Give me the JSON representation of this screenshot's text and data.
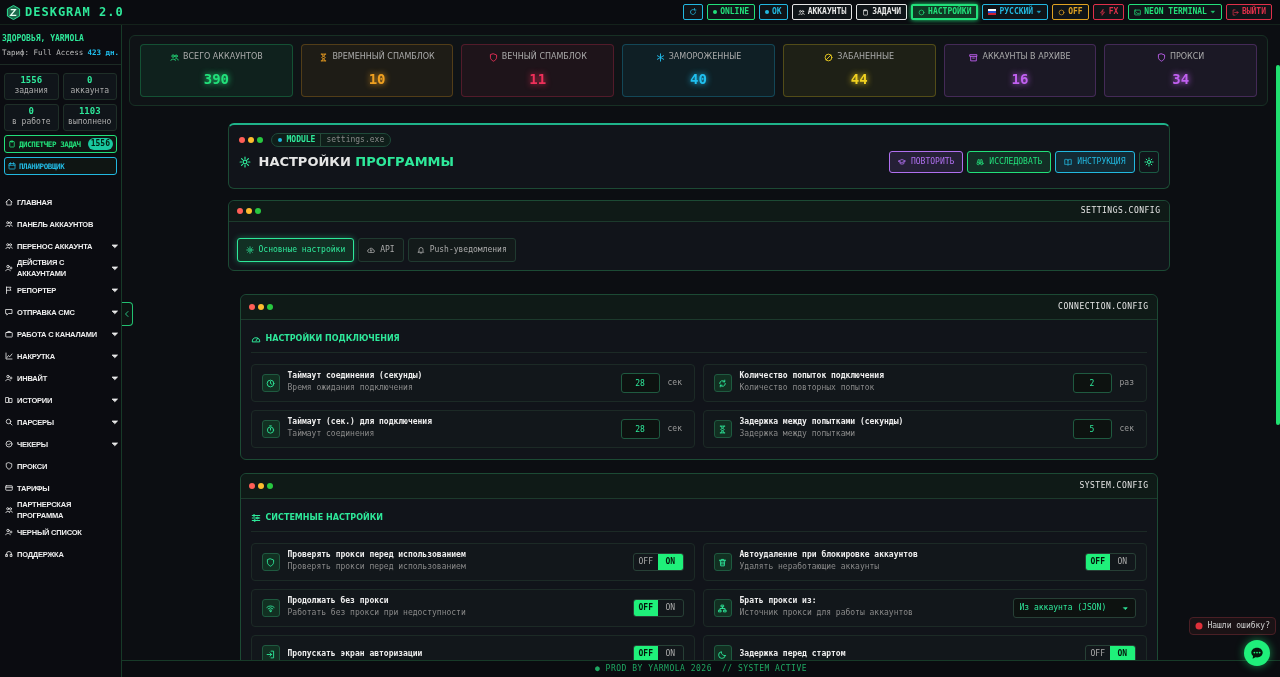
{
  "app": {
    "title": "DESKGRAM 2.0"
  },
  "topbar": [
    {
      "kind": "icon",
      "color": "#22b8e0",
      "selected": false
    },
    {
      "kind": "status",
      "label": "ONLINE",
      "color": "#22e07a",
      "selected": false
    },
    {
      "kind": "status",
      "label": "OK",
      "color": "#22b8e0",
      "selected": false
    },
    {
      "kind": "nav",
      "label": "АККАУНТЫ",
      "color": "#e6e6e6",
      "selected": false
    },
    {
      "kind": "nav",
      "label": "ЗАДАЧИ",
      "color": "#e6e6e6",
      "selected": false
    },
    {
      "kind": "nav",
      "label": "НАСТРОЙКИ",
      "color": "#22e07a",
      "selected": true
    },
    {
      "kind": "dropdown",
      "label": "РУССКИЙ",
      "color": "#22b8e0",
      "selected": false
    },
    {
      "kind": "nav",
      "label": "OFF",
      "color": "#e0a222",
      "selected": false
    },
    {
      "kind": "nav",
      "label": "FX",
      "color": "#e0304a",
      "selected": false
    },
    {
      "kind": "dropdown",
      "label": "NEON TERMINAL",
      "color": "#22e07a",
      "selected": false
    },
    {
      "kind": "nav",
      "label": "ВЫЙТИ",
      "color": "#e0304a",
      "selected": false
    }
  ],
  "sidebar": {
    "greeting": "ЗДОРОВЬЯ, YARMOLA",
    "plan": "Тариф: Full Access",
    "days": "423 дн.",
    "counters": [
      {
        "value": "1556",
        "label": "задания"
      },
      {
        "value": "0",
        "label": "аккаунта"
      },
      {
        "value": "0",
        "label": "в работе"
      },
      {
        "value": "1103",
        "label": "выполнено"
      }
    ],
    "actions": [
      {
        "label": "ДИСПЕТЧЕР ЗАДАЧ",
        "badge": "1556",
        "color": "#22e07a"
      },
      {
        "label": "ПЛАНИРОВЩИК",
        "color": "#22b8e0"
      }
    ],
    "menu": [
      {
        "label": "ГЛАВНАЯ",
        "expandable": false
      },
      {
        "label": "ПАНЕЛЬ АККАУНТОВ",
        "expandable": false
      },
      {
        "label": "ПЕРЕНОС АККАУНТА",
        "expandable": true
      },
      {
        "label": "ДЕЙСТВИЯ С АККАУНТАМИ",
        "expandable": true
      },
      {
        "label": "РЕПОРТЕР",
        "expandable": true
      },
      {
        "label": "ОТПРАВКА СМС",
        "expandable": true
      },
      {
        "label": "РАБОТА С КАНАЛАМИ",
        "expandable": true
      },
      {
        "label": "НАКРУТКА",
        "expandable": true
      },
      {
        "label": "ИНВАЙТ",
        "expandable": true
      },
      {
        "label": "ИСТОРИИ",
        "expandable": true
      },
      {
        "label": "ПАРСЕРЫ",
        "expandable": true
      },
      {
        "label": "ЧЕКЕРЫ",
        "expandable": true
      },
      {
        "label": "ПРОКСИ",
        "expandable": false
      },
      {
        "label": "ТАРИФЫ",
        "expandable": false
      },
      {
        "label": "ПАРТНЕРСКАЯ ПРОГРАММА",
        "expandable": false
      },
      {
        "label": "ЧЕРНЫЙ СПИСОК",
        "expandable": false
      },
      {
        "label": "ПОДДЕРЖКА",
        "expandable": false
      }
    ]
  },
  "stats": [
    {
      "label": "ВСЕГО АККАУНТОВ",
      "value": "390",
      "color": "#22e07a"
    },
    {
      "label": "ВРЕМЕННЫЙ СПАМБЛОК",
      "value": "10",
      "color": "#f0a020"
    },
    {
      "label": "ВЕЧНЫЙ СПАМБЛОК",
      "value": "11",
      "color": "#f0305a"
    },
    {
      "label": "ЗАМОРОЖЕННЫЕ",
      "value": "40",
      "color": "#20c0f0"
    },
    {
      "label": "ЗАБАНЕННЫЕ",
      "value": "44",
      "color": "#f0d020"
    },
    {
      "label": "АККАУНТЫ В АРХИВЕ",
      "value": "16",
      "color": "#c060f0"
    },
    {
      "label": "ПРОКСИ",
      "value": "34",
      "color": "#c060f0"
    }
  ],
  "page": {
    "module_tag": "MODULE",
    "module_file": "settings.exe",
    "title": "НАСТРОЙКИ",
    "title_accent": "ПРОГРАММЫ",
    "buttons": [
      {
        "label": "ПОВТОРИТЬ",
        "color": "#b070f0"
      },
      {
        "label": "ИССЛЕДОВАТЬ",
        "color": "#22e07a"
      },
      {
        "label": "ИНСТРУКЦИЯ",
        "color": "#22b8e0"
      }
    ]
  },
  "tabs_panel": {
    "file": "SETTINGS.CONFIG",
    "tabs": [
      {
        "label": "Основные настройки",
        "selected": true
      },
      {
        "label": "API",
        "selected": false
      },
      {
        "label": "Push-уведомления",
        "selected": false
      }
    ]
  },
  "sections": [
    {
      "file": "CONNECTION.CONFIG",
      "title": "НАСТРОЙКИ ПОДКЛЮЧЕНИЯ",
      "rows": [
        {
          "kind": "number",
          "label": "Таймаут соединения (секунды)",
          "hint": "Время ожидания подключения",
          "value": "28",
          "unit": "сек"
        },
        {
          "kind": "number",
          "label": "Количество попыток подключения",
          "hint": "Количество повторных попыток",
          "value": "2",
          "unit": "раз"
        },
        {
          "kind": "number",
          "label": "Таймаут (сек.) для подключения",
          "hint": "Таймаут соединения",
          "value": "28",
          "unit": "сек"
        },
        {
          "kind": "number",
          "label": "Задержка между попытками (секунды)",
          "hint": "Задержка между попытками",
          "value": "5",
          "unit": "сек"
        }
      ]
    },
    {
      "file": "SYSTEM.CONFIG",
      "title": "СИСТЕМНЫЕ НАСТРОЙКИ",
      "rows": [
        {
          "kind": "toggle",
          "label": "Проверять прокси перед использованием",
          "hint": "Проверять прокси перед использованием",
          "off_label": "OFF",
          "on_label": "ON",
          "on": true
        },
        {
          "kind": "toggle",
          "label": "Автоудаление при блокировке аккаунтов",
          "hint": "Удалять неработающие аккаунты",
          "off_label": "OFF",
          "on_label": "ON",
          "on": false
        },
        {
          "kind": "toggle",
          "label": "Продолжать без прокси",
          "hint": "Работать без прокси при недоступности",
          "off_label": "OFF",
          "on_label": "ON",
          "on": false
        },
        {
          "kind": "select",
          "label": "Брать прокси из:",
          "hint": "Источник прокси для работы аккаунтов",
          "value": "Из аккаунта (JSON)"
        },
        {
          "kind": "toggle",
          "label": "Пропускать экран авторизации",
          "off_label": "OFF",
          "on_label": "ON",
          "on": false
        },
        {
          "kind": "toggle",
          "label": "Задержка перед стартом",
          "off_label": "OFF",
          "on_label": "ON",
          "on": true
        }
      ]
    }
  ],
  "footer": {
    "credit": "● PROD BY YARMOLA 2026",
    "status": "// SYSTEM ACTIVE"
  },
  "report": {
    "label": "Нашли ошибку?"
  }
}
